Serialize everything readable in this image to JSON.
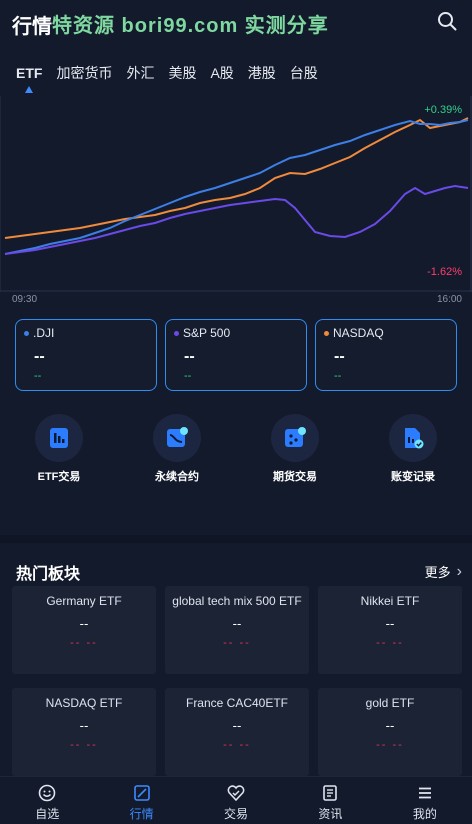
{
  "header": {
    "title": "行情",
    "watermark": "特资源 bori99.com 实测分享",
    "search_icon": "search-icon"
  },
  "tabs": [
    {
      "label": "ETF",
      "active": true
    },
    {
      "label": "加密货币",
      "active": false
    },
    {
      "label": "外汇",
      "active": false
    },
    {
      "label": "美股",
      "active": false
    },
    {
      "label": "A股",
      "active": false
    },
    {
      "label": "港股",
      "active": false
    },
    {
      "label": "台股",
      "active": false
    }
  ],
  "chart_data": {
    "type": "line",
    "max_label": "+0.39%",
    "min_label": "-1.62%",
    "x_start": "09:30",
    "x_end": "16:00",
    "series_colors": {
      "dji": "#3d7fe6",
      "sp500": "#6a4ae8",
      "nasdaq": "#f08a3c"
    }
  },
  "indices": [
    {
      "name": ".DJI",
      "price": "--",
      "change": "--",
      "color": "#3d7fe6"
    },
    {
      "name": "S&P 500",
      "price": "--",
      "change": "--",
      "color": "#6a4ae8"
    },
    {
      "name": "NASDAQ",
      "price": "--",
      "change": "--",
      "color": "#f08a3c"
    }
  ],
  "actions": [
    {
      "label": "ETF交易",
      "icon": "etf-chart-icon"
    },
    {
      "label": "永续合约",
      "icon": "perpetual-contract-icon"
    },
    {
      "label": "期货交易",
      "icon": "futures-icon"
    },
    {
      "label": "账变记录",
      "icon": "account-record-icon"
    }
  ],
  "hot": {
    "title": "热门板块",
    "more": "更多",
    "sectors": [
      {
        "name": "Germany ETF",
        "price": "--",
        "change": "-- --"
      },
      {
        "name": "global tech mix 500 ETF",
        "price": "--",
        "change": "-- --"
      },
      {
        "name": "Nikkei ETF",
        "price": "--",
        "change": "-- --"
      },
      {
        "name": "NASDAQ ETF",
        "price": "--",
        "change": "-- --"
      },
      {
        "name": "France CAC40ETF",
        "price": "--",
        "change": "-- --"
      },
      {
        "name": "gold ETF",
        "price": "--",
        "change": "-- --"
      }
    ]
  },
  "nav": [
    {
      "label": "自选",
      "icon": "smiley-icon",
      "active": false
    },
    {
      "label": "行情",
      "icon": "market-icon",
      "active": true
    },
    {
      "label": "交易",
      "icon": "trade-icon",
      "active": false
    },
    {
      "label": "资讯",
      "icon": "news-icon",
      "active": false
    },
    {
      "label": "我的",
      "icon": "menu-icon",
      "active": false
    }
  ],
  "colors": {
    "accent": "#3d8bff",
    "up": "#2fd28a",
    "down": "#ff3e6c",
    "background": "#131a2c"
  }
}
